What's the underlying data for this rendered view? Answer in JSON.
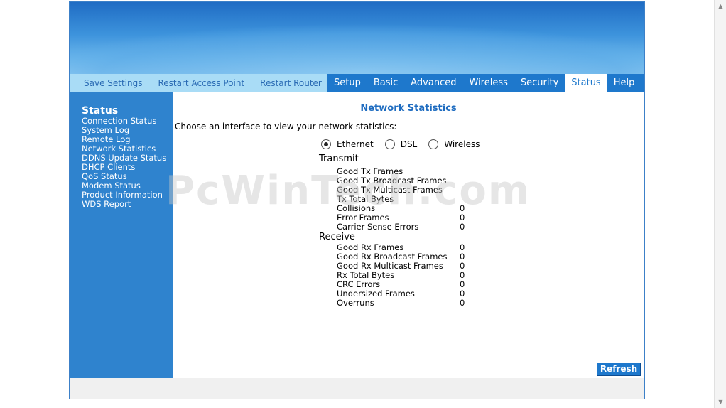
{
  "topnav": {
    "left": [
      "Save Settings",
      "Restart Access Point",
      "Restart Router"
    ],
    "tabs": [
      "Setup",
      "Basic",
      "Advanced",
      "Wireless",
      "Security",
      "Status",
      "Help"
    ],
    "active_tab": "Status"
  },
  "sidebar": {
    "title": "Status",
    "items": [
      "Connection Status",
      "System Log",
      "Remote Log",
      "Network Statistics",
      "DDNS Update Status",
      "DHCP Clients",
      "QoS Status",
      "Modem Status",
      "Product Information",
      "WDS Report"
    ]
  },
  "main": {
    "title": "Network Statistics",
    "instruction": "Choose an interface to view your network statistics:",
    "radios": [
      "Ethernet",
      "DSL",
      "Wireless"
    ],
    "selected_radio": "Ethernet",
    "transmit": {
      "heading": "Transmit",
      "rows": [
        {
          "label": "Good Tx Frames",
          "value": ""
        },
        {
          "label": "Good Tx Broadcast Frames",
          "value": ""
        },
        {
          "label": "Good Tx Multicast Frames",
          "value": ""
        },
        {
          "label": "Tx Total Bytes",
          "value": ""
        },
        {
          "label": "Collisions",
          "value": "0"
        },
        {
          "label": "Error Frames",
          "value": "0"
        },
        {
          "label": "Carrier Sense Errors",
          "value": "0"
        }
      ]
    },
    "receive": {
      "heading": "Receive",
      "rows": [
        {
          "label": "Good Rx Frames",
          "value": "0"
        },
        {
          "label": "Good Rx Broadcast Frames",
          "value": "0"
        },
        {
          "label": "Good Rx Multicast Frames",
          "value": "0"
        },
        {
          "label": "Rx Total Bytes",
          "value": "0"
        },
        {
          "label": "CRC Errors",
          "value": "0"
        },
        {
          "label": "Undersized Frames",
          "value": "0"
        },
        {
          "label": "Overruns",
          "value": "0"
        }
      ]
    },
    "refresh_label": "Refresh"
  },
  "watermark": "PcWinTech.com"
}
